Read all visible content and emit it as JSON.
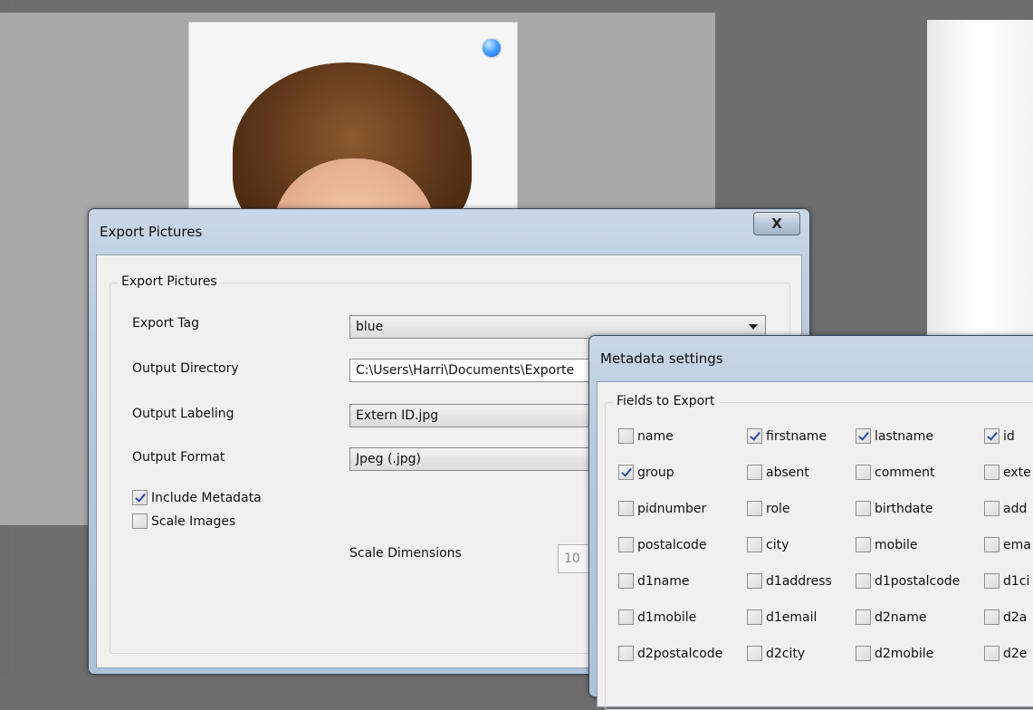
{
  "export_dialog": {
    "title": "Export Pictures",
    "close_label": "X",
    "group_title": "Export Pictures",
    "export_tag": {
      "label": "Export Tag",
      "value": "blue"
    },
    "output_directory": {
      "label": "Output Directory",
      "value": "C:\\Users\\Harri\\Documents\\Exporte"
    },
    "output_labeling": {
      "label": "Output Labeling",
      "value": "Extern ID.jpg"
    },
    "output_format": {
      "label": "Output Format",
      "value": "Jpeg (.jpg)"
    },
    "include_metadata": {
      "label": "Include Metadata",
      "checked": true
    },
    "scale_images": {
      "label": "Scale Images",
      "checked": false
    },
    "scale_dimensions": {
      "label": "Scale Dimensions",
      "value": "10"
    }
  },
  "metadata_dialog": {
    "title": "Metadata settings",
    "group_title": "Fields to Export",
    "fields": [
      {
        "label": "name",
        "checked": false
      },
      {
        "label": "firstname",
        "checked": true
      },
      {
        "label": "lastname",
        "checked": true
      },
      {
        "label": "id",
        "checked": true
      },
      {
        "label": "group",
        "checked": true
      },
      {
        "label": "absent",
        "checked": false
      },
      {
        "label": "comment",
        "checked": false
      },
      {
        "label": "exte",
        "checked": false
      },
      {
        "label": "pidnumber",
        "checked": false
      },
      {
        "label": "role",
        "checked": false
      },
      {
        "label": "birthdate",
        "checked": false
      },
      {
        "label": "add",
        "checked": false
      },
      {
        "label": "postalcode",
        "checked": false
      },
      {
        "label": "city",
        "checked": false
      },
      {
        "label": "mobile",
        "checked": false
      },
      {
        "label": "ema",
        "checked": false
      },
      {
        "label": "d1name",
        "checked": false
      },
      {
        "label": "d1address",
        "checked": false
      },
      {
        "label": "d1postalcode",
        "checked": false
      },
      {
        "label": "d1ci",
        "checked": false
      },
      {
        "label": "d1mobile",
        "checked": false
      },
      {
        "label": "d1email",
        "checked": false
      },
      {
        "label": "d2name",
        "checked": false
      },
      {
        "label": "d2a",
        "checked": false
      },
      {
        "label": "d2postalcode",
        "checked": false
      },
      {
        "label": "d2city",
        "checked": false
      },
      {
        "label": "d2mobile",
        "checked": false
      },
      {
        "label": "d2e",
        "checked": false
      }
    ]
  },
  "background": {
    "tag_color": "#2f86f0"
  }
}
